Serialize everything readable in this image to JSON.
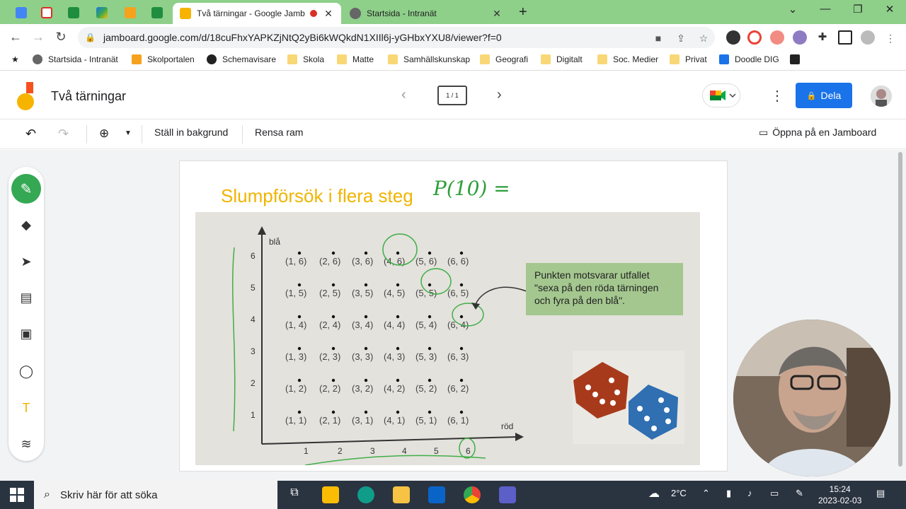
{
  "browser": {
    "tabs": [
      {
        "title": "Två tärningar - Google Jamb",
        "active": true
      },
      {
        "title": "Startsida - Intranät",
        "active": false
      }
    ],
    "new_tab": "+",
    "url": "jamboard.google.com/d/18cuFhxYAPKZjNtQ2yBi6kWQkdN1XIIl6j-yGHbxYXU8/viewer?f=0",
    "bookmarks": [
      "Startsida - Intranät",
      "Skolportalen",
      "Schemavisare",
      "Skola",
      "Matte",
      "Samhällskunskap",
      "Geografi",
      "Digitalt",
      "Soc. Medier",
      "Privat",
      "Doodle DIG"
    ]
  },
  "jamboard": {
    "title": "Två tärningar",
    "frame_indicator": "1 / 1",
    "share_label": "Dela",
    "toolbar": {
      "background": "Ställ in bakgrund",
      "clear": "Rensa ram",
      "open": "Öppna på en Jamboard"
    },
    "slide": {
      "heading": "Slumpförsök i flera steg",
      "handwriting": "P(10) =",
      "y_axis_label": "blå",
      "x_axis_label": "röd",
      "ticks": [
        "1",
        "2",
        "3",
        "4",
        "5",
        "6"
      ],
      "outcomes": [
        [
          "(1, 6)",
          "(2, 6)",
          "(3, 6)",
          "(4, 6)",
          "(5, 6)",
          "(6, 6)"
        ],
        [
          "(1, 5)",
          "(2, 5)",
          "(3, 5)",
          "(4, 5)",
          "(5, 5)",
          "(6, 5)"
        ],
        [
          "(1, 4)",
          "(2, 4)",
          "(3, 4)",
          "(4, 4)",
          "(5, 4)",
          "(6, 4)"
        ],
        [
          "(1, 3)",
          "(2, 3)",
          "(3, 3)",
          "(4, 3)",
          "(5, 3)",
          "(6, 3)"
        ],
        [
          "(1, 2)",
          "(2, 2)",
          "(3, 2)",
          "(4, 2)",
          "(5, 2)",
          "(6, 2)"
        ],
        [
          "(1, 1)",
          "(2, 1)",
          "(3, 1)",
          "(4, 1)",
          "(5, 1)",
          "(6, 1)"
        ]
      ],
      "callout": [
        "Punkten motsvarar utfallet",
        "\"sexa på den röda tärningen",
        "och fyra på den blå\"."
      ]
    }
  },
  "taskbar": {
    "search_placeholder": "Skriv här för att söka",
    "temperature": "2°C",
    "time": "15:24",
    "date": "2023-02-03"
  },
  "colors": {
    "tab_strip": "#8ecf8a",
    "heading": "#f0b400",
    "share": "#1a73e8",
    "annotation": "#2e9e3a"
  }
}
